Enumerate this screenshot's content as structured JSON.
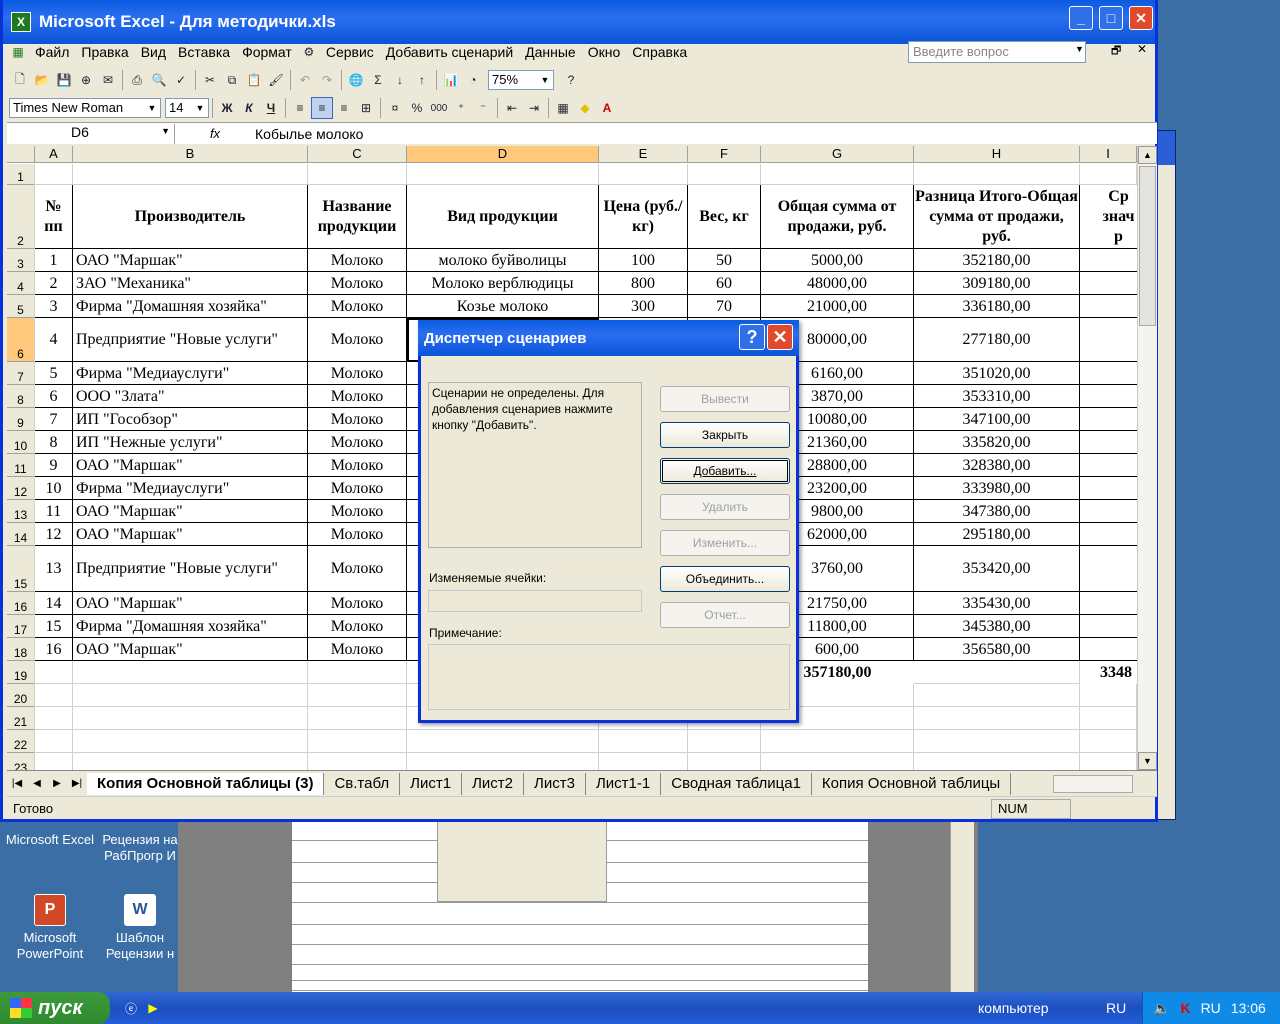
{
  "window": {
    "title": "Microsoft Excel - Для методички.xls"
  },
  "menu": [
    "Файл",
    "Правка",
    "Вид",
    "Вставка",
    "Формат",
    "Сервис",
    "Добавить сценарий",
    "Данные",
    "Окно",
    "Справка"
  ],
  "ask_placeholder": "Введите вопрос",
  "toolbar": {
    "zoom": "75%",
    "font": "Times New Roman",
    "size": "14",
    "bold": "Ж",
    "italic": "К",
    "underline": "Ч",
    "percent": "%",
    "thousands": "000"
  },
  "formula_bar": {
    "cell_ref": "D6",
    "fx": "fx",
    "value": "Кобылье молоко"
  },
  "columns": [
    "A",
    "B",
    "C",
    "D",
    "E",
    "F",
    "G",
    "H",
    "I"
  ],
  "header_row": {
    "num": "№ пп",
    "producer": "Производитель",
    "name": "Название продукции",
    "kind": "Вид продукции",
    "price": "Цена (руб./кг)",
    "weight": "Вес, кг",
    "total": "Общая сумма от продажи, руб.",
    "diff": "Разница Итого-Общая сумма от продажи, руб.",
    "avg": "Ср знач р"
  },
  "rows": [
    {
      "r": "3",
      "n": "1",
      "p": "ОАО \"Маршак\"",
      "c": "Молоко",
      "d": "молоко буйволицы",
      "e": "100",
      "f": "50",
      "g": "5000,00",
      "h": "352180,00"
    },
    {
      "r": "4",
      "n": "2",
      "p": "ЗАО \"Механика\"",
      "c": "Молоко",
      "d": "Молоко верблюдицы",
      "e": "800",
      "f": "60",
      "g": "48000,00",
      "h": "309180,00"
    },
    {
      "r": "5",
      "n": "3",
      "p": "Фирма \"Домашняя хозяйка\"",
      "c": "Молоко",
      "d": "Козье молоко",
      "e": "300",
      "f": "70",
      "g": "21000,00",
      "h": "336180,00"
    },
    {
      "r": "6",
      "n": "4",
      "p": "Предприятие \"Новые услуги\"",
      "c": "Молоко",
      "d": "",
      "e": "",
      "f": "",
      "g": "80000,00",
      "h": "277180,00"
    },
    {
      "r": "7",
      "n": "5",
      "p": "Фирма \"Медиауслуги\"",
      "c": "Молоко",
      "d": "",
      "e": "",
      "f": "",
      "g": "6160,00",
      "h": "351020,00"
    },
    {
      "r": "8",
      "n": "6",
      "p": "ООО \"Злата\"",
      "c": "Молоко",
      "d": "",
      "e": "",
      "f": "",
      "g": "3870,00",
      "h": "353310,00"
    },
    {
      "r": "9",
      "n": "7",
      "p": "ИП \"Гособзор\"",
      "c": "Молоко",
      "d": "",
      "e": "",
      "f": "",
      "g": "10080,00",
      "h": "347100,00"
    },
    {
      "r": "10",
      "n": "8",
      "p": "ИП \"Нежные услуги\"",
      "c": "Молоко",
      "d": "",
      "e": "",
      "f": "",
      "g": "21360,00",
      "h": "335820,00"
    },
    {
      "r": "11",
      "n": "9",
      "p": "ОАО \"Маршак\"",
      "c": "Молоко",
      "d": "",
      "e": "",
      "f": "",
      "g": "28800,00",
      "h": "328380,00"
    },
    {
      "r": "12",
      "n": "10",
      "p": "Фирма \"Медиауслуги\"",
      "c": "Молоко",
      "d": "",
      "e": "",
      "f": "",
      "g": "23200,00",
      "h": "333980,00"
    },
    {
      "r": "13",
      "n": "11",
      "p": "ОАО \"Маршак\"",
      "c": "Молоко",
      "d": "",
      "e": "",
      "f": "",
      "g": "9800,00",
      "h": "347380,00"
    },
    {
      "r": "14",
      "n": "12",
      "p": "ОАО \"Маршак\"",
      "c": "Молоко",
      "d": "",
      "e": "",
      "f": "",
      "g": "62000,00",
      "h": "295180,00"
    },
    {
      "r": "15",
      "n": "13",
      "p": "Предприятие \"Новые услуги\"",
      "c": "Молоко",
      "d": "",
      "e": "",
      "f": "",
      "g": "3760,00",
      "h": "353420,00"
    },
    {
      "r": "16",
      "n": "14",
      "p": "ОАО \"Маршак\"",
      "c": "Молоко",
      "d": "",
      "e": "",
      "f": "",
      "g": "21750,00",
      "h": "335430,00"
    },
    {
      "r": "17",
      "n": "15",
      "p": "Фирма \"Домашняя хозяйка\"",
      "c": "Молоко",
      "d": "",
      "e": "",
      "f": "",
      "g": "11800,00",
      "h": "345380,00"
    },
    {
      "r": "18",
      "n": "16",
      "p": "ОАО \"Маршак\"",
      "c": "Молоко",
      "d": "",
      "e": "",
      "f": "",
      "g": "600,00",
      "h": "356580,00"
    }
  ],
  "row19": {
    "g": "357180,00",
    "i": "3348"
  },
  "empty_rows": [
    "1",
    "19",
    "20",
    "21",
    "22",
    "23"
  ],
  "tabs": [
    "Копия Основной таблицы (3)",
    "Св.табл",
    "Лист1",
    "Лист2",
    "Лист3",
    "Лист1-1",
    "Сводная таблица1",
    "Копия Основной таблицы"
  ],
  "status": {
    "ready": "Готово",
    "num": "NUM"
  },
  "dialog": {
    "title": "Диспетчер сценариев",
    "message": "Сценарии не определены. Для добавления сценариев нажмите кнопку \"Добавить\".",
    "changing_cells": "Изменяемые ячейки:",
    "note": "Примечание:",
    "buttons": [
      "Вывести",
      "Закрыть",
      "Добавить...",
      "Удалить",
      "Изменить...",
      "Объединить...",
      "Отчет..."
    ]
  },
  "desktop_icons": [
    {
      "label": "Microsoft Excel"
    },
    {
      "label": "Рецензия на РабПрогр И"
    },
    {
      "label": "Microsoft PowerPoint"
    },
    {
      "label": "Шаблон Рецензии н"
    }
  ],
  "taskbar": {
    "start": "пуск",
    "computer": "компьютер",
    "lang": "RU",
    "lang2": "RU",
    "time": "13:06"
  }
}
